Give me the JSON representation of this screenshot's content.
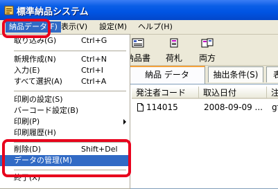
{
  "window": {
    "title": "標準納品システム"
  },
  "menubar": {
    "items": [
      {
        "label": "納品データ(F)"
      },
      {
        "label": "表示(V)"
      },
      {
        "label": "設定(M)"
      },
      {
        "label": "ヘルプ(H)"
      }
    ]
  },
  "toolbar": {
    "buttons": [
      {
        "label": "納品書",
        "icon": "invoice-icon"
      },
      {
        "label": "荷札",
        "icon": "tag-icon"
      },
      {
        "label": "両方",
        "icon": "both-icon"
      }
    ]
  },
  "tabs": [
    {
      "label": "納品 データ"
    },
    {
      "label": "抽出条件(S)"
    },
    {
      "label": "表"
    }
  ],
  "list": {
    "columns": [
      "発注者コード",
      "取込日付",
      "注"
    ],
    "rows": [
      {
        "code": "114015",
        "date": "2008-09-09 ...",
        "note": "gfo"
      }
    ]
  },
  "menu": {
    "items": [
      {
        "label": "取り込み(G)",
        "shortcut": "Ctrl+G"
      },
      {
        "label": "新規作成(N)",
        "shortcut": "Ctrl+N"
      },
      {
        "label": "入力(E)",
        "shortcut": "Ctrl+I"
      },
      {
        "label": "すべて選択(A)",
        "shortcut": "Ctrl+A"
      },
      {
        "label": "印刷の設定(S)",
        "shortcut": ""
      },
      {
        "label": "バーコード設定(B)",
        "shortcut": ""
      },
      {
        "label": "印刷(P)",
        "shortcut": ""
      },
      {
        "label": "印刷履歴(H)",
        "shortcut": ""
      },
      {
        "label": "削除(D)",
        "shortcut": "Shift+Del"
      },
      {
        "label": "データの管理(M)",
        "shortcut": ""
      },
      {
        "label": "終了(X)",
        "shortcut": ""
      }
    ]
  },
  "colors": {
    "highlight": "#316ac5",
    "annotation": "#e8001c",
    "titlebar": "#0054e3"
  }
}
